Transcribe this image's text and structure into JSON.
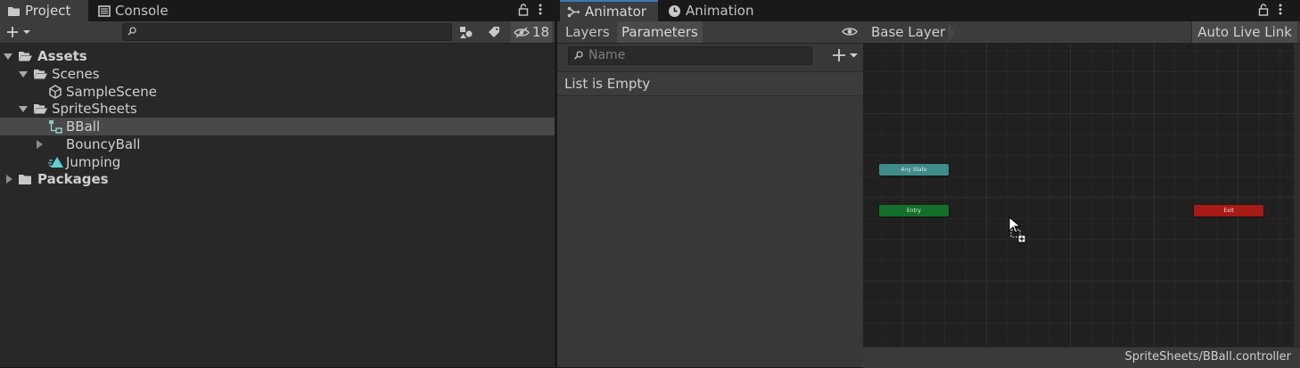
{
  "project_window": {
    "tabs": [
      {
        "label": "Project",
        "icon": "folder-icon",
        "active": true
      },
      {
        "label": "Console",
        "icon": "console-icon",
        "active": false
      }
    ],
    "hidden_count": "18",
    "tree": [
      {
        "label": "Assets",
        "icon": "folder-open-icon",
        "bold": true,
        "expanded": true,
        "depth": 0
      },
      {
        "label": "Scenes",
        "icon": "folder-open-icon",
        "expanded": true,
        "depth": 1
      },
      {
        "label": "SampleScene",
        "icon": "unity-scene-icon",
        "depth": 2
      },
      {
        "label": "SpriteSheets",
        "icon": "folder-open-icon",
        "expanded": true,
        "depth": 1
      },
      {
        "label": "BBall",
        "icon": "animator-controller-icon",
        "depth": 2,
        "selected": true
      },
      {
        "label": "BouncyBall",
        "icon": "sprite-icon",
        "depth": 2,
        "collapsed": true
      },
      {
        "label": "Jumping",
        "icon": "animation-clip-icon",
        "depth": 2
      },
      {
        "label": "Packages",
        "icon": "folder-icon",
        "bold": true,
        "collapsed": true,
        "depth": 0
      }
    ]
  },
  "animator_window": {
    "tabs": [
      {
        "label": "Animator",
        "icon": "animator-icon",
        "active": true
      },
      {
        "label": "Animation",
        "icon": "animation-clock-icon",
        "active": false
      }
    ],
    "panel_tabs": [
      {
        "label": "Layers",
        "active": false
      },
      {
        "label": "Parameters",
        "active": true
      }
    ],
    "search_placeholder": "Name",
    "list_empty_text": "List is Empty",
    "breadcrumb": "Base Layer",
    "live_link_button": "Auto Live Link",
    "states": {
      "any_state": {
        "label": "Any State",
        "color": "#3f8c8a"
      },
      "entry": {
        "label": "Entry",
        "color": "#13702a"
      },
      "exit": {
        "label": "Exit",
        "color": "#a81a16"
      }
    },
    "status_path": "SpriteSheets/BBall.controller"
  }
}
